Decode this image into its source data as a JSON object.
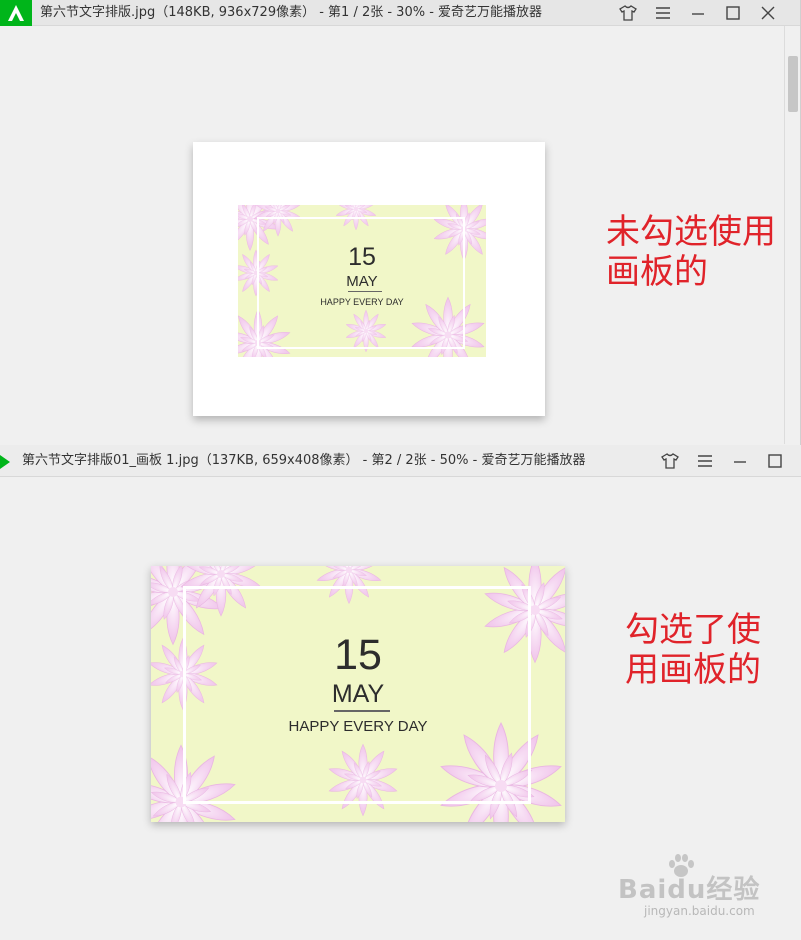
{
  "window1": {
    "title": "第六节文字排版.jpg（148KB, 936x729像素） - 第1 / 2张 - 30% - 爱奇艺万能播放器",
    "annotation_line1": "未勾选使用",
    "annotation_line2": "画板的"
  },
  "window2": {
    "title": "第六节文字排版01_画板 1.jpg（137KB, 659x408像素） - 第2 / 2张 - 50% - 爱奇艺万能播放器",
    "annotation_line1": "勾选了使",
    "annotation_line2": "用画板的"
  },
  "poster": {
    "day": "15",
    "month": "MAY",
    "tagline": "HAPPY  EVERY  DAY"
  },
  "watermark": {
    "brand": "Baidu经验",
    "url": "jingyan.baidu.com"
  },
  "icons": {
    "app": "iqiyi-player-icon",
    "skin": "tshirt-icon",
    "menu": "hamburger-menu-icon",
    "minimize": "minimize-icon",
    "maximize": "maximize-icon",
    "close": "close-icon"
  },
  "colors": {
    "annotation": "#e0232a",
    "app_green": "#00b51a",
    "poster_bg": "#f1f7c8",
    "petal": "#f3c9ee"
  }
}
